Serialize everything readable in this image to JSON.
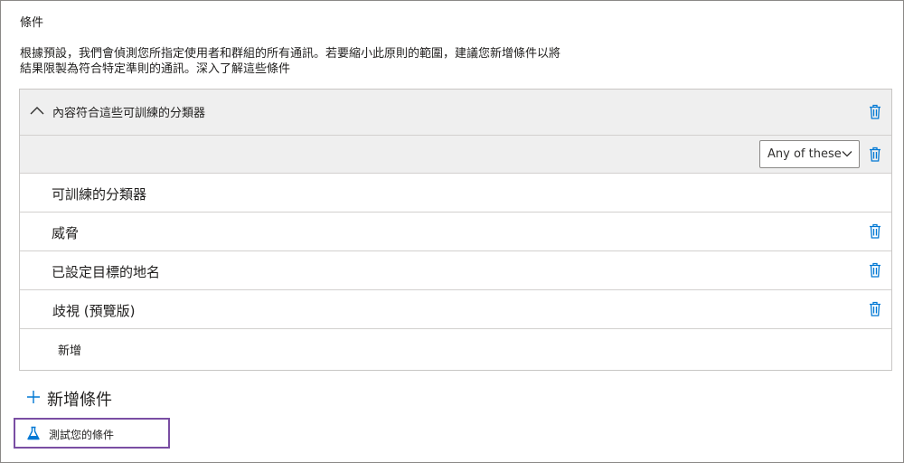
{
  "section": {
    "title": "條件",
    "description": "根據預設，我們會偵測您所指定使用者和群組的所有通訊。若要縮小此原則的範圍，建議您新增條件以將結果限製為符合特定準則的通訊。",
    "learn_more": "深入了解這些條件"
  },
  "condition_group": {
    "title": "內容符合這些可訓練的分類器",
    "operator": "Any of these",
    "items": [
      {
        "label": "可訓練的分類器"
      },
      {
        "label": "威脅"
      },
      {
        "label": "已設定目標的地名"
      },
      {
        "label": "歧視 (預覽版)"
      }
    ],
    "add_label": "新增"
  },
  "actions": {
    "add_condition": "新增條件",
    "test_conditions": "測試您的條件"
  },
  "colors": {
    "accent": "#0078d4",
    "highlight_border": "#7a4ea3",
    "header_bg": "#efefef"
  },
  "icons": {
    "delete": "trash-icon",
    "collapse": "chevron-up-icon",
    "dropdown": "chevron-down-icon",
    "add": "plus-icon",
    "test": "beaker-icon"
  }
}
